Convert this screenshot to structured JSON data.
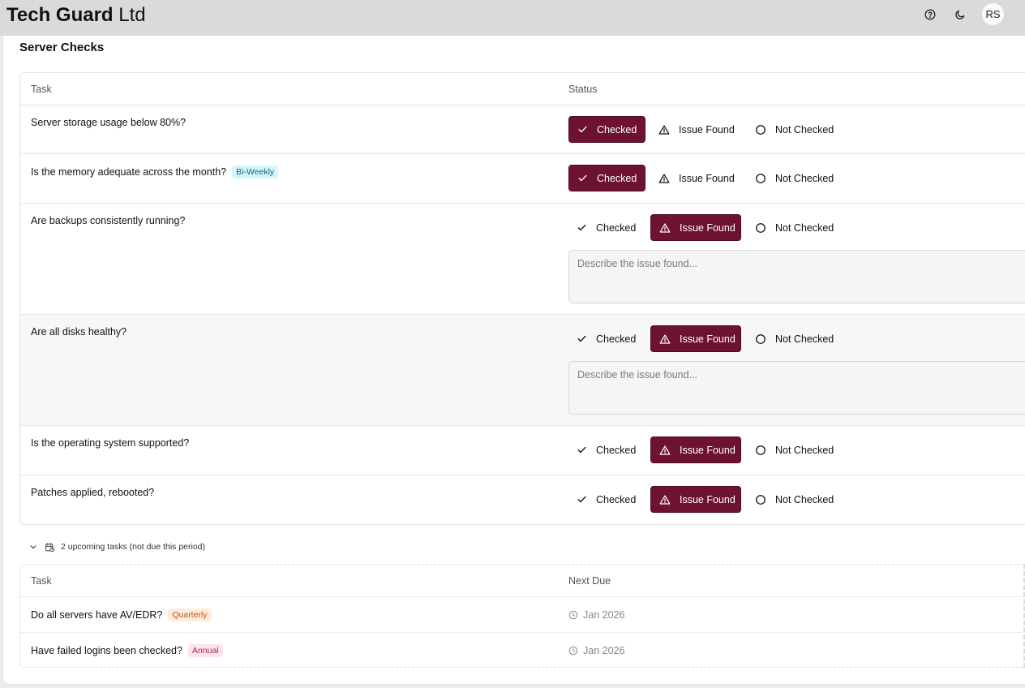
{
  "app": {
    "brand_bold": "Tech Guard",
    "brand_light": "Ltd",
    "avatar_initials": "RS"
  },
  "icons": {
    "help": "help-circle-icon",
    "theme": "moon-icon",
    "checked": "check-icon",
    "issue": "warning-triangle-icon",
    "not_checked": "circle-icon",
    "expand": "chevron-down-icon",
    "calendar": "calendar-clock-icon",
    "due": "clock-icon"
  },
  "colors": {
    "accent": "#6e1234",
    "topbar": "#dadada"
  },
  "section": {
    "title": "Server Checks"
  },
  "table": {
    "headers": {
      "task": "Task",
      "status": "Status"
    },
    "options": {
      "checked": "Checked",
      "issue": "Issue Found",
      "not_checked": "Not Checked"
    },
    "issue_placeholder": "Describe the issue found...",
    "rows": [
      {
        "task": "Server storage usage below 80%?",
        "status": "checked"
      },
      {
        "task": "Is the memory adequate across the month?",
        "badge": "Bi-Weekly",
        "status": "checked"
      },
      {
        "task": "Are backups consistently running?",
        "status": "issue"
      },
      {
        "task": "Are all disks healthy?",
        "status": "issue"
      },
      {
        "task": "Is the operating system supported?",
        "status": "issue"
      },
      {
        "task": "Patches applied, rebooted?",
        "status": "issue"
      }
    ]
  },
  "upcoming": {
    "summary": "2 upcoming tasks (not due this period)",
    "headers": {
      "task": "Task",
      "next_due": "Next Due"
    },
    "rows": [
      {
        "task": "Do all servers have AV/EDR?",
        "badge": "Quarterly",
        "due": "Jan 2026"
      },
      {
        "task": "Have failed logins been checked?",
        "badge": "Annual",
        "due": "Jan 2026"
      }
    ]
  }
}
